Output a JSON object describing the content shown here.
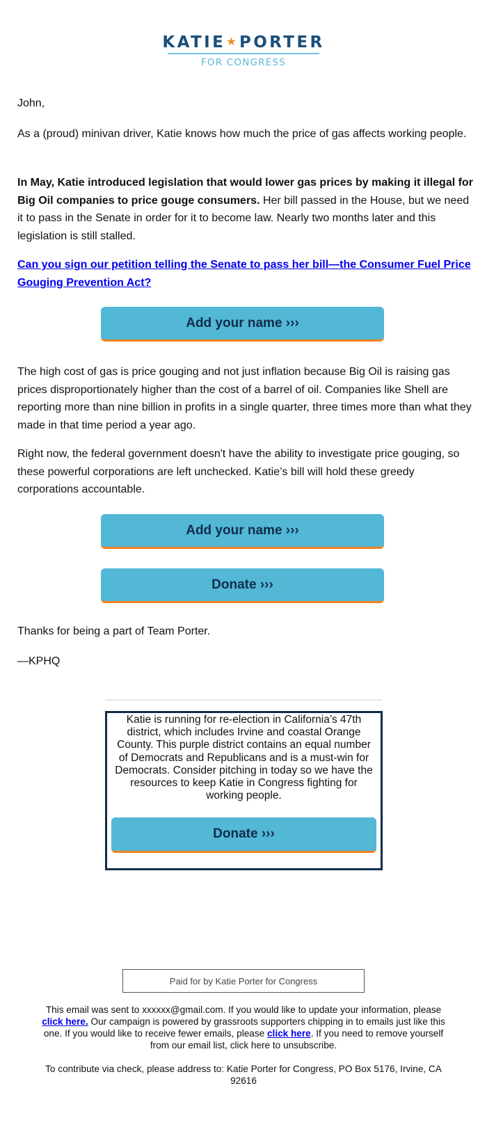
{
  "logo": {
    "name_left": "KATIE",
    "star_icon": "★",
    "name_right": "PORTER",
    "subtitle": "FOR CONGRESS"
  },
  "body": {
    "greeting": "John,",
    "para1": "As a (proud) minivan driver, Katie knows how much the price of gas affects working people.",
    "para2_bold": "In May, Katie introduced legislation that would lower gas prices by making it illegal for Big Oil companies to price gouge consumers.",
    "para2_rest": " Her bill passed in the House, but we need it to pass in the Senate in order for it to become law. Nearly two months later and this legislation is still stalled.",
    "petition_link": "Can you sign our petition telling the Senate to pass her bill—the Consumer Fuel Price Gouging Prevention Act?",
    "para3": "The high cost of gas is price gouging and not just inflation because Big Oil is raising gas prices disproportionately higher than the cost of a barrel of oil. Companies like Shell are reporting more than nine billion in profits in a single quarter, three times more than what they made in that time period a year ago.",
    "para4": "Right now, the federal government doesn't have the ability to investigate price gouging, so these powerful corporations are left unchecked. Katie’s bill will hold these greedy corporations accountable.",
    "thanks": "Thanks for being a part of Team Porter.",
    "signature": "—KPHQ"
  },
  "buttons": {
    "add_name_1": "Add your name ›››",
    "add_name_2": "Add your name ›››",
    "donate_1": "Donate ›››",
    "donate_box": "Donate ›››"
  },
  "callout": {
    "text": "Katie is running for re-election in California’s 47th district, which includes Irvine and coastal Orange County. This purple district contains an equal number of Democrats and Republicans and is a must-win for Democrats. Consider pitching in today so we have the resources to keep Katie in Congress fighting for working people."
  },
  "footer": {
    "paid_for": "Paid for by Katie Porter for Congress",
    "line1_a": "This email was sent to xxxxxx@gmail.com. If you would like to update your information, please ",
    "link1": "click here.",
    "line1_b": " Our campaign is powered by grassroots supporters chipping in to emails just like this one. If you would like to receive fewer emails, please ",
    "link2": "click here",
    "line1_c": ". If you need to remove yourself from our email list, click here to unsubscribe.",
    "address": "To contribute via check, please address to: Katie Porter for Congress, PO Box 5176, Irvine, CA 92616"
  },
  "colors": {
    "brand_navy": "#1b4f7a",
    "button_blue": "#53b7d6",
    "button_accent": "#f5821f",
    "link": "#0000ee"
  }
}
